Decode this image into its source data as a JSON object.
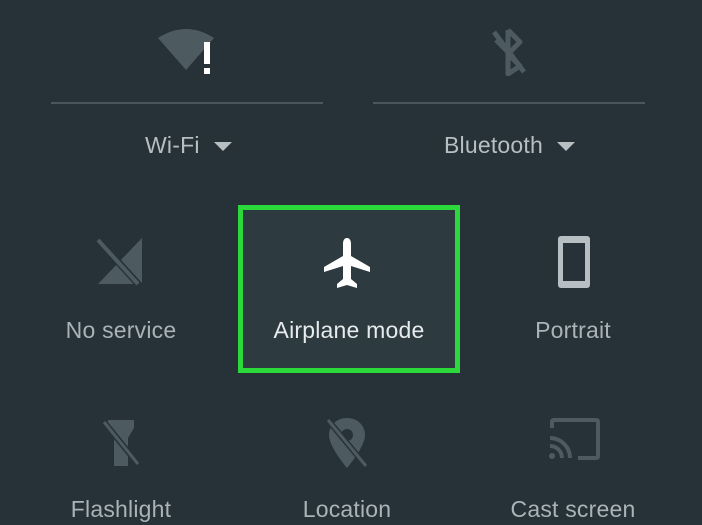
{
  "quick_settings": {
    "wifi": {
      "label": "Wi-Fi"
    },
    "bluetooth": {
      "label": "Bluetooth"
    },
    "tiles": [
      {
        "label": "No service",
        "icon": "no-signal-icon"
      },
      {
        "label": "Airplane mode",
        "icon": "airplane-icon",
        "active": true
      },
      {
        "label": "Portrait",
        "icon": "phone-portrait-icon"
      },
      {
        "label": "Flashlight",
        "icon": "flashlight-off-icon"
      },
      {
        "label": "Location",
        "icon": "location-off-icon"
      },
      {
        "label": "Cast screen",
        "icon": "cast-icon"
      }
    ]
  },
  "colors": {
    "background": "#263238",
    "highlight": "#2bd93a",
    "icon_dim": "#4d5a60",
    "icon_active": "#ffffff"
  }
}
